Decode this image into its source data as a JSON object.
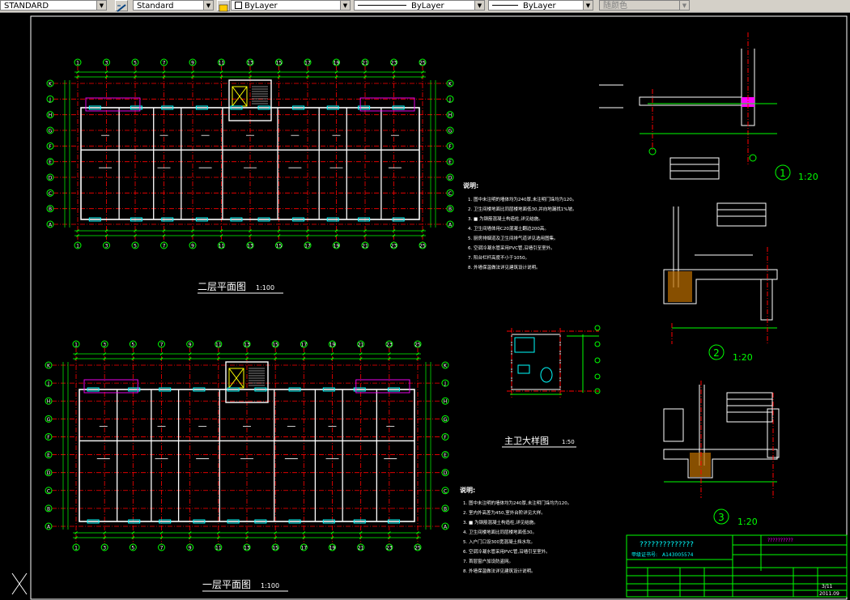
{
  "toolbar": {
    "text_style": "STANDARD",
    "dim_style": "Standard",
    "layer": "ByLayer",
    "linetype": "ByLayer",
    "lineweight": "ByLayer",
    "color": "随颜色"
  },
  "drawing": {
    "plan_upper_title": "二层平面图",
    "plan_upper_scale": "1:100",
    "plan_lower_title": "一层平面图",
    "plan_lower_scale": "1:100",
    "bath_title": "主卫大样图",
    "bath_scale": "1:50",
    "detail1_num": "1",
    "detail1_scale": "1:20",
    "detail2_num": "2",
    "detail2_scale": "1:20",
    "detail3_num": "3",
    "detail3_scale": "1:20",
    "notes_title": "说明:",
    "notes_upper": [
      "1. 图中未注明的墙体均为240厚,未注明门垛均为120。",
      "2. 卫生间楼地面比同层楼地面低30,并向地漏找1%坡。",
      "3. ■ 为钢筋混凝土构造柱,详见结施。",
      "4. 卫生间墙体用C20混凝土翻边200高。",
      "5. 厨房排烟道及卫生间排气道详见选用图集。",
      "6. 空调冷凝水管采用PVC管,沿墙引至室外。",
      "7. 阳台栏杆高度不小于1050。",
      "8. 外墙保温做法详见建筑设计说明。"
    ],
    "notes_lower": [
      "1. 图中未注明的墙体均为240厚,未注明门垛均为120。",
      "2. 室内外高差为450,室外台阶详见大样。",
      "3. ■ 为钢筋混凝土构造柱,详见结施。",
      "4. 卫生间楼地面比同层楼地面低30。",
      "5. 入户门口设300宽混凝土挡水坎。",
      "6. 空调冷凝水管采用PVC管,沿墙引至室外。",
      "7. 首层窗户加设防盗网。",
      "8. 外墙保温做法详见建筑设计说明。"
    ],
    "upper_axes": [
      "1",
      "3",
      "5",
      "7",
      "9",
      "11",
      "13",
      "15",
      "17",
      "19",
      "21",
      "23",
      "25"
    ],
    "lower_axes": [
      "1",
      "3",
      "5",
      "7",
      "9",
      "11",
      "13",
      "15",
      "17",
      "19",
      "21",
      "23",
      "25"
    ],
    "side_axes": [
      "K",
      "J",
      "H",
      "G",
      "F",
      "E",
      "D",
      "C",
      "B",
      "A"
    ],
    "title_block": {
      "project": "??????????????",
      "cert_label": "甲级证书号:",
      "cert_no": "A143005574",
      "sheet_name": "??????????",
      "sheet_no": "3/11",
      "date": "2011.09"
    }
  }
}
